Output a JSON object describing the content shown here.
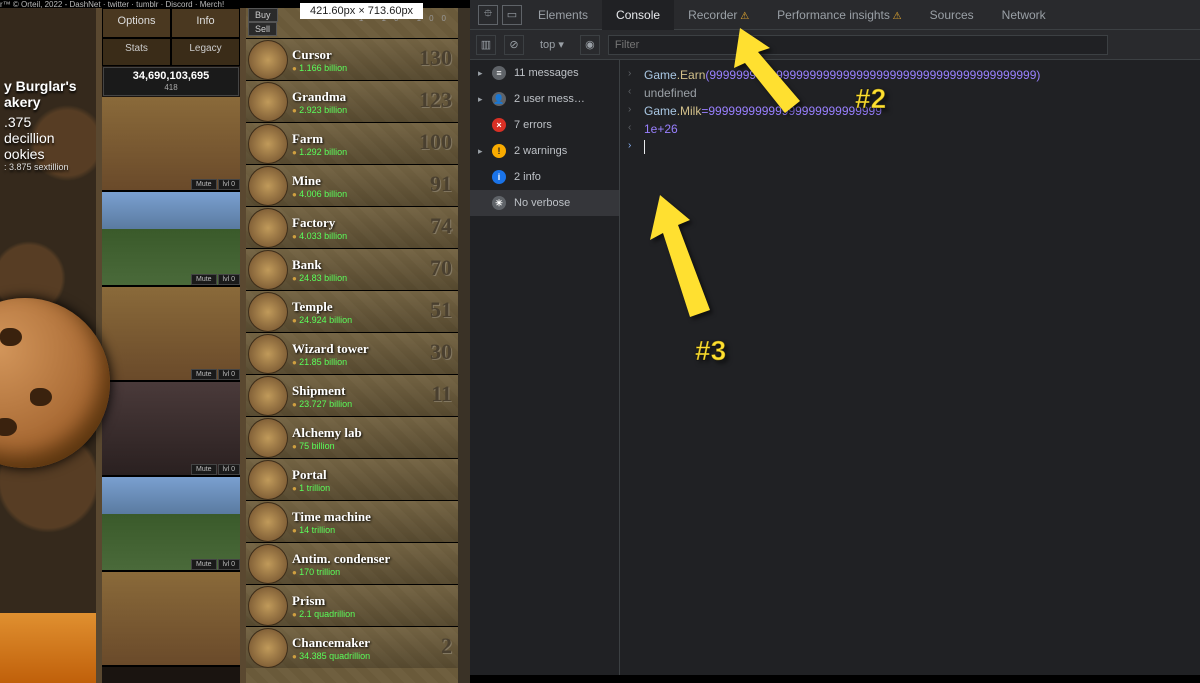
{
  "topbar": "r™ © Orteil, 2022 - DashNet · twitter · tumblr · Discord · Merch!",
  "dimlabel": "421.60px × 713.60px",
  "bakery": {
    "name": "y Burglar's",
    "name2": "akery",
    "count": ".375\ndecillion\nookies",
    "cps": ": 3.875 sextillion"
  },
  "cookiebar": {
    "val": "34,690,103,695",
    "badge": "418"
  },
  "menu": {
    "options": "Options",
    "info": "Info",
    "stats": "Stats",
    "legacy": "Legacy"
  },
  "bview_btn": {
    "mute": "Mute",
    "lvl": "lvl 0"
  },
  "buysell": {
    "buy": "Buy",
    "sell": "Sell",
    "qty": "1   10   100"
  },
  "products": [
    {
      "name": "Cursor",
      "price": "1.166 billion",
      "owned": "130"
    },
    {
      "name": "Grandma",
      "price": "2.923 billion",
      "owned": "123"
    },
    {
      "name": "Farm",
      "price": "1.292 billion",
      "owned": "100"
    },
    {
      "name": "Mine",
      "price": "4.006 billion",
      "owned": "91"
    },
    {
      "name": "Factory",
      "price": "4.033 billion",
      "owned": "74"
    },
    {
      "name": "Bank",
      "price": "24.83 billion",
      "owned": "70"
    },
    {
      "name": "Temple",
      "price": "24.924 billion",
      "owned": "51"
    },
    {
      "name": "Wizard tower",
      "price": "21.85 billion",
      "owned": "30"
    },
    {
      "name": "Shipment",
      "price": "23.727 billion",
      "owned": "11"
    },
    {
      "name": "Alchemy lab",
      "price": "75 billion",
      "owned": ""
    },
    {
      "name": "Portal",
      "price": "1 trillion",
      "owned": ""
    },
    {
      "name": "Time machine",
      "price": "14 trillion",
      "owned": ""
    },
    {
      "name": "Antim. condenser",
      "price": "170 trillion",
      "owned": ""
    },
    {
      "name": "Prism",
      "price": "2.1 quadrillion",
      "owned": ""
    },
    {
      "name": "Chancemaker",
      "price": "34.385 quadrillion",
      "owned": "2"
    }
  ],
  "dt": {
    "tabs": {
      "elements": "Elements",
      "console": "Console",
      "recorder": "Recorder",
      "perf": "Performance insights",
      "sources": "Sources",
      "network": "Network"
    },
    "sub": {
      "top": "top",
      "filter": "Filter"
    },
    "side": {
      "msg": "11 messages",
      "user": "2 user mess…",
      "err": "7 errors",
      "warn": "2 warnings",
      "info": "2 info",
      "verb": "No verbose"
    },
    "cons": {
      "l1a": "Game",
      "l1b": ".Earn",
      "l1c": "(9999999999999999999999999999999999999999999999999)",
      "l2": "undefined",
      "l3a": "Game",
      "l3b": ".Milk",
      "l3c": "=99999999999999999999999999",
      "l4": "1e+26"
    }
  },
  "anno": {
    "n2": "#2",
    "n3": "#3"
  }
}
